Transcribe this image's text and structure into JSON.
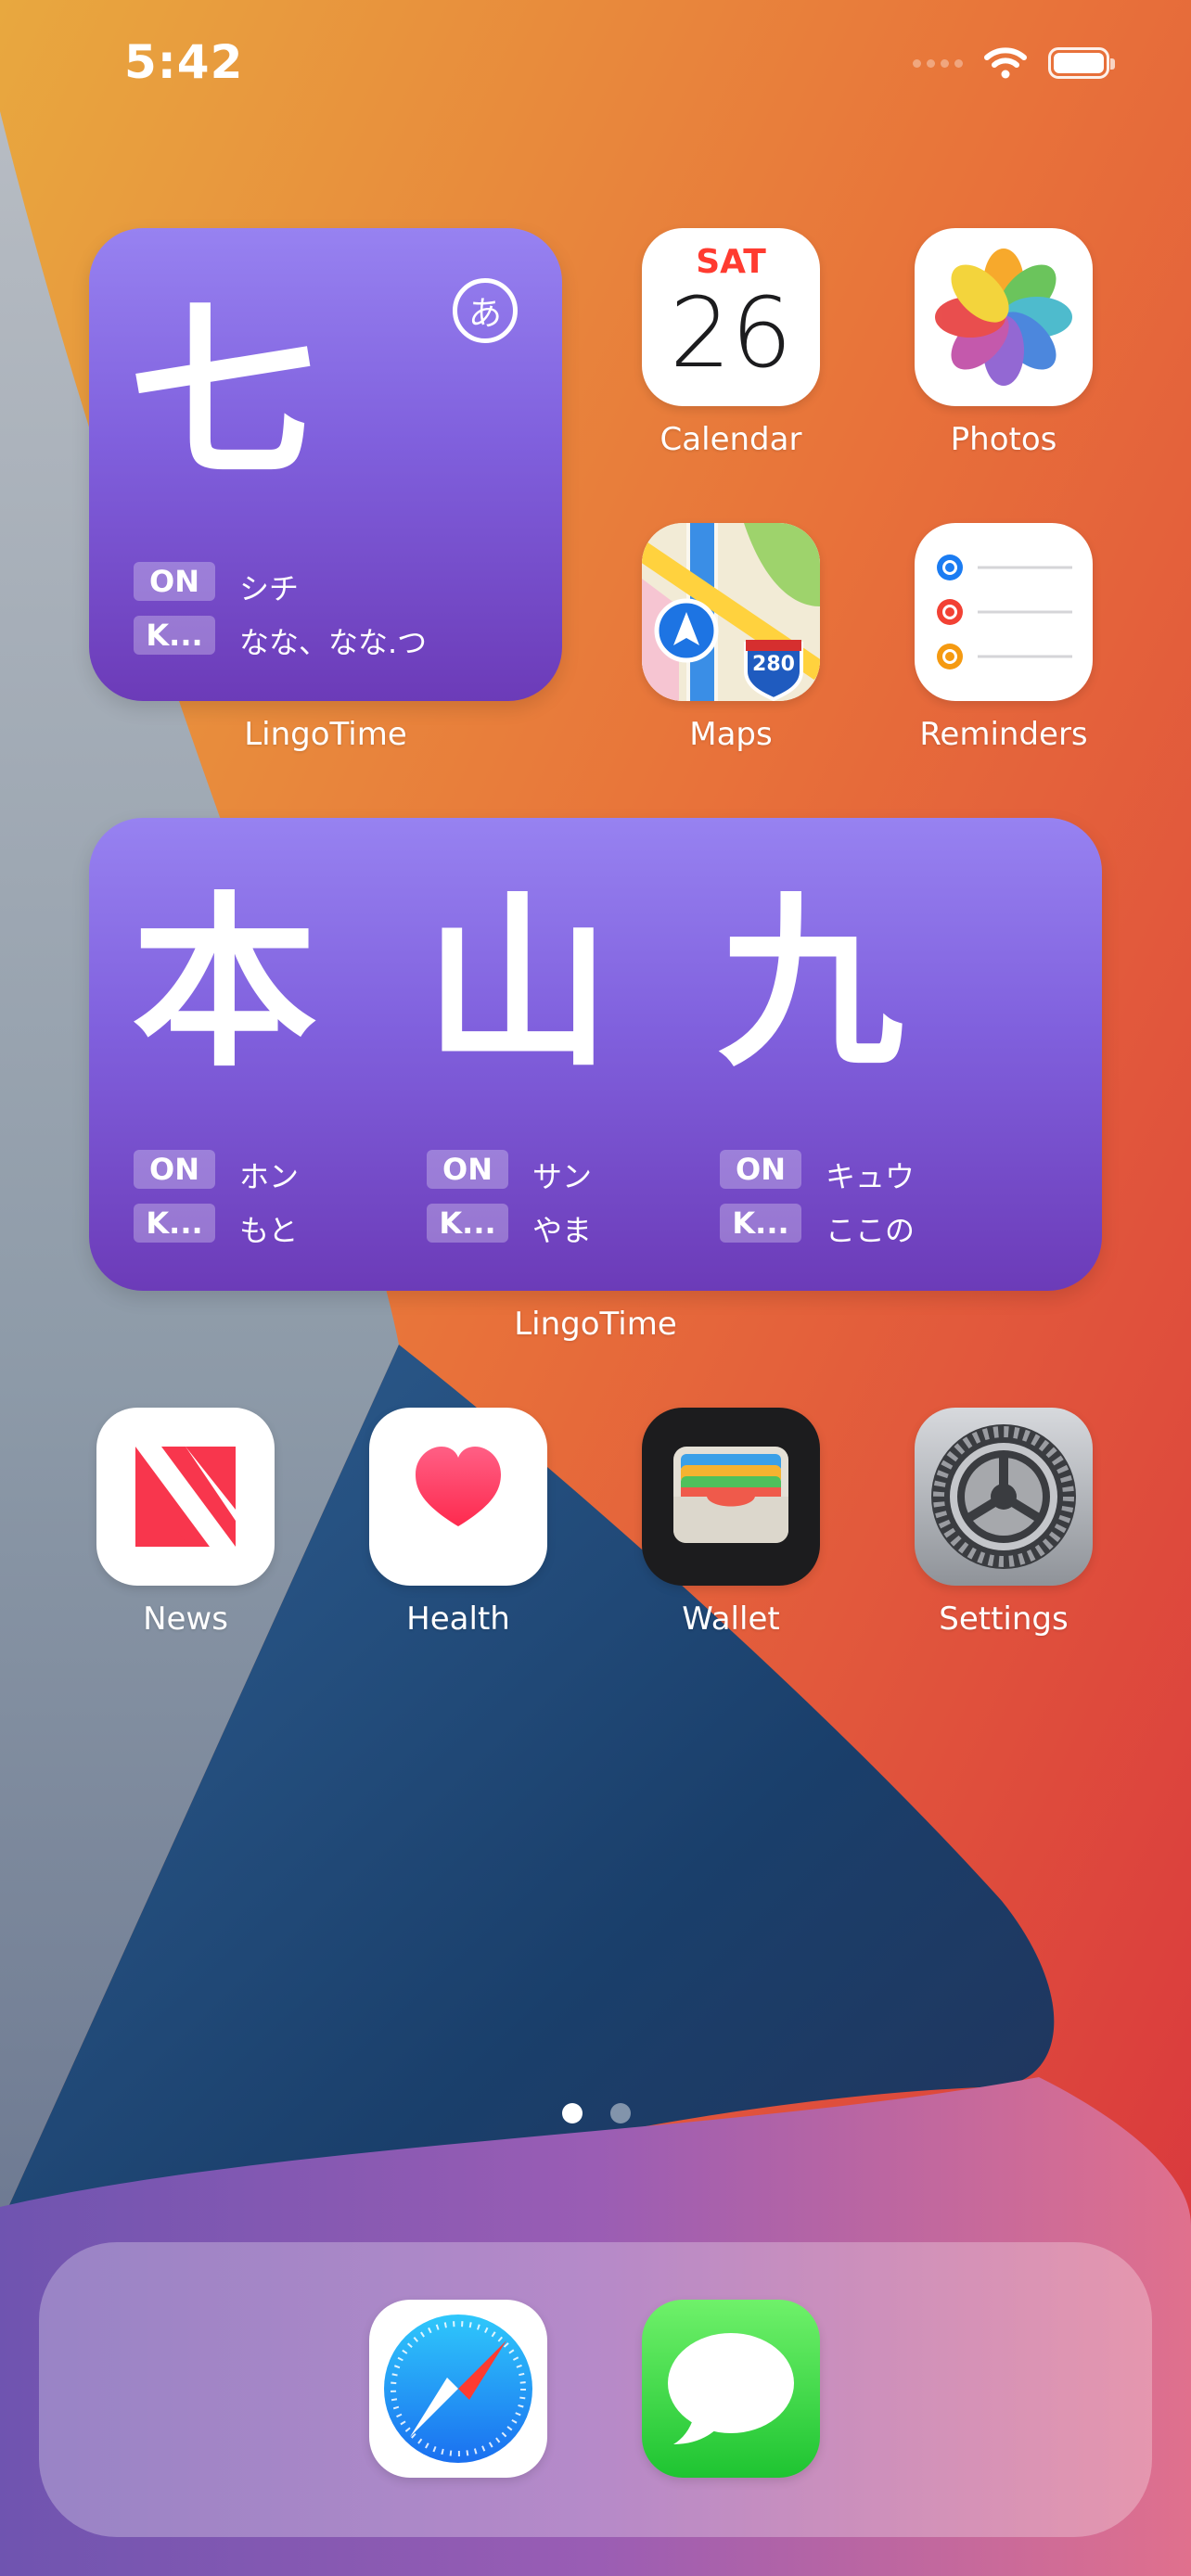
{
  "status_bar": {
    "time": "5:42"
  },
  "widget_small": {
    "kanji": "七",
    "on_label": "ON",
    "on_reading": "シチ",
    "kun_label": "K...",
    "kun_reading": "なな、なな.つ",
    "app_label": "LingoTime",
    "logo_char": "あ"
  },
  "widget_large": {
    "app_label": "LingoTime",
    "entries": [
      {
        "kanji": "本",
        "on_label": "ON",
        "on_reading": "ホン",
        "kun_label": "K...",
        "kun_reading": "もと"
      },
      {
        "kanji": "山",
        "on_label": "ON",
        "on_reading": "サン",
        "kun_label": "K...",
        "kun_reading": "やま"
      },
      {
        "kanji": "九",
        "on_label": "ON",
        "on_reading": "キュウ",
        "kun_label": "K...",
        "kun_reading": "ここの"
      }
    ]
  },
  "apps": {
    "calendar": {
      "label": "Calendar",
      "day": "SAT",
      "date": "26"
    },
    "photos": {
      "label": "Photos"
    },
    "maps": {
      "label": "Maps",
      "route": "280"
    },
    "reminders": {
      "label": "Reminders"
    },
    "news": {
      "label": "News"
    },
    "health": {
      "label": "Health"
    },
    "wallet": {
      "label": "Wallet"
    },
    "settings": {
      "label": "Settings"
    }
  },
  "dock": {
    "apps": [
      "Safari",
      "Messages"
    ]
  },
  "page_indicator": {
    "pages": 2,
    "current": 1
  },
  "colors": {
    "widget_top": "#9782f1",
    "widget_bottom": "#6c3bb8",
    "calendar_red": "#ff3b30",
    "messages_green": "#34c759"
  }
}
